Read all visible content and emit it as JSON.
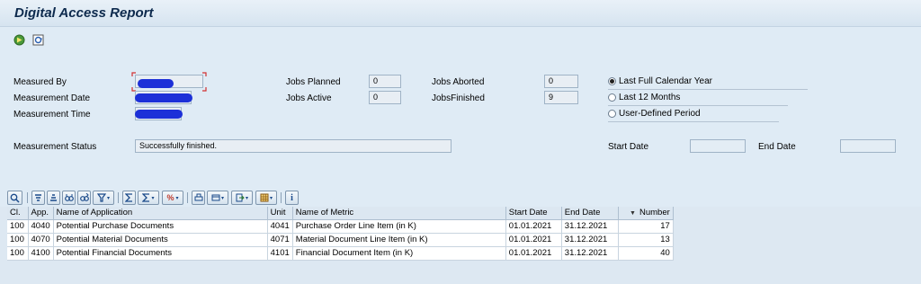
{
  "title": "Digital Access Report",
  "toolbar": {
    "icons": [
      "execute-icon",
      "refresh-icon"
    ]
  },
  "form": {
    "measured_by": {
      "label": "Measured By",
      "value": ""
    },
    "measurement_date": {
      "label": "Measurement Date",
      "value": ""
    },
    "measurement_time": {
      "label": "Measurement Time",
      "value": ""
    },
    "jobs_planned": {
      "label": "Jobs Planned",
      "value": "0"
    },
    "jobs_active": {
      "label": "Jobs Active",
      "value": "0"
    },
    "jobs_aborted": {
      "label": "Jobs Aborted",
      "value": "0"
    },
    "jobs_finished": {
      "label": "JobsFinished",
      "value": "9"
    },
    "measurement_status": {
      "label": "Measurement Status",
      "value": "Successfully finished."
    },
    "start_date": {
      "label": "Start Date",
      "value": ""
    },
    "end_date": {
      "label": "End Date",
      "value": ""
    },
    "period_options": [
      {
        "label": "Last Full Calendar Year",
        "selected": true
      },
      {
        "label": "Last 12 Months",
        "selected": false
      },
      {
        "label": "User-Defined Period",
        "selected": false
      }
    ]
  },
  "table": {
    "columns": [
      "Cl.",
      "App.",
      "Name of Application",
      "Unit",
      "Name of Metric",
      "Start Date",
      "End Date",
      "Number"
    ],
    "rows": [
      [
        "100",
        "4040",
        "Potential Purchase Documents",
        "4041",
        "Purchase Order Line Item (in K)",
        "01.01.2021",
        "31.12.2021",
        "17"
      ],
      [
        "100",
        "4070",
        "Potential Material Documents",
        "4071",
        "Material Document Line Item (in K)",
        "01.01.2021",
        "31.12.2021",
        "13"
      ],
      [
        "100",
        "4100",
        "Potential Financial Documents",
        "4101",
        "Financial Document Item (in K)",
        "01.01.2021",
        "31.12.2021",
        "40"
      ]
    ]
  }
}
